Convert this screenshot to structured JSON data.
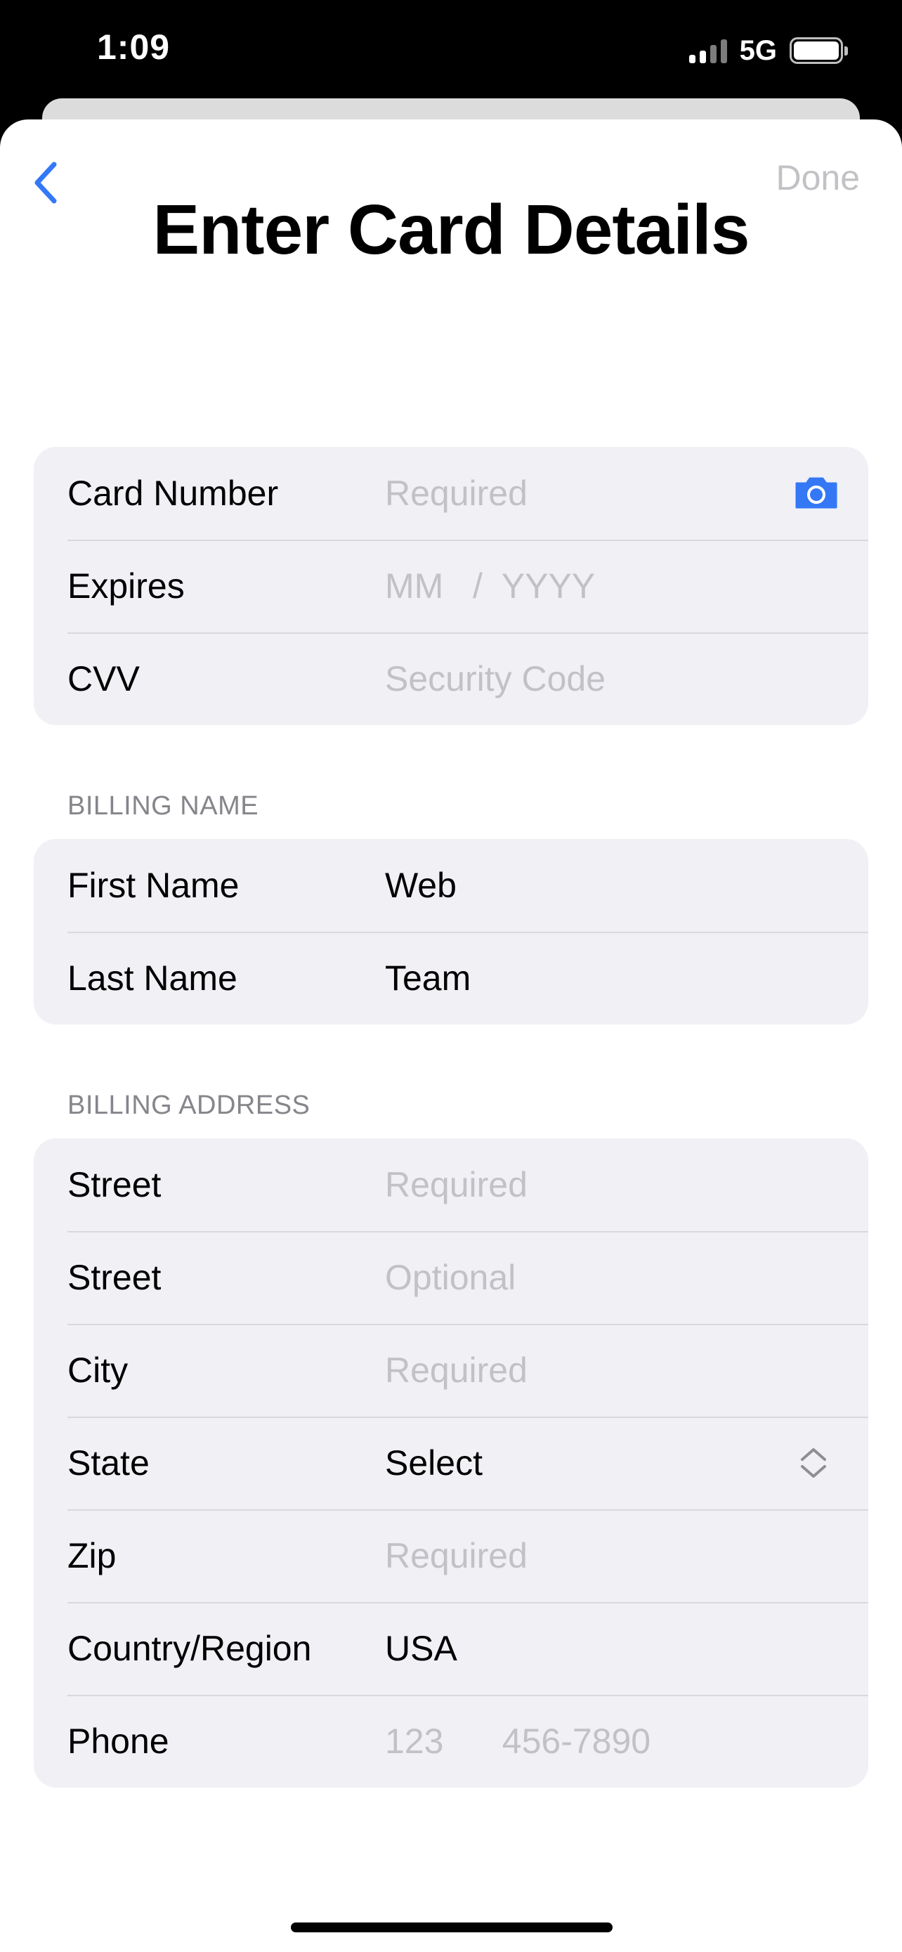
{
  "status_bar": {
    "time": "1:09",
    "network": "5G",
    "signal_strength_bars": 2,
    "battery_level": 1.0
  },
  "nav": {
    "back_icon": "chevron-left-icon",
    "done_label": "Done"
  },
  "title": "Enter Card Details",
  "card_section": {
    "rows": [
      {
        "label": "Card Number",
        "value": "Required",
        "is_placeholder": true,
        "icon": "camera-icon"
      },
      {
        "label": "Expires",
        "value": "MM   /  YYYY",
        "is_placeholder": true
      },
      {
        "label": "CVV",
        "value": "Security Code",
        "is_placeholder": true
      }
    ]
  },
  "billing_name": {
    "header": "BILLING NAME",
    "rows": [
      {
        "label": "First Name",
        "value": "Web",
        "is_placeholder": false
      },
      {
        "label": "Last Name",
        "value": "Team",
        "is_placeholder": false
      }
    ]
  },
  "billing_address": {
    "header": "BILLING ADDRESS",
    "rows": [
      {
        "label": "Street",
        "value": "Required",
        "is_placeholder": true
      },
      {
        "label": "Street",
        "value": "Optional",
        "is_placeholder": true
      },
      {
        "label": "City",
        "value": "Required",
        "is_placeholder": true
      },
      {
        "label": "State",
        "value": "Select",
        "is_placeholder": false,
        "icon": "chevron-up-down-icon"
      },
      {
        "label": "Zip",
        "value": "Required",
        "is_placeholder": true
      },
      {
        "label": "Country/Region",
        "value": "USA",
        "is_placeholder": false
      },
      {
        "label": "Phone",
        "value": "123      456-7890",
        "is_placeholder": true
      }
    ]
  },
  "colors": {
    "accent": "#3478f6",
    "placeholder": "#c1c1c6",
    "group_background": "#f0f0f5",
    "section_header": "#85858b"
  }
}
